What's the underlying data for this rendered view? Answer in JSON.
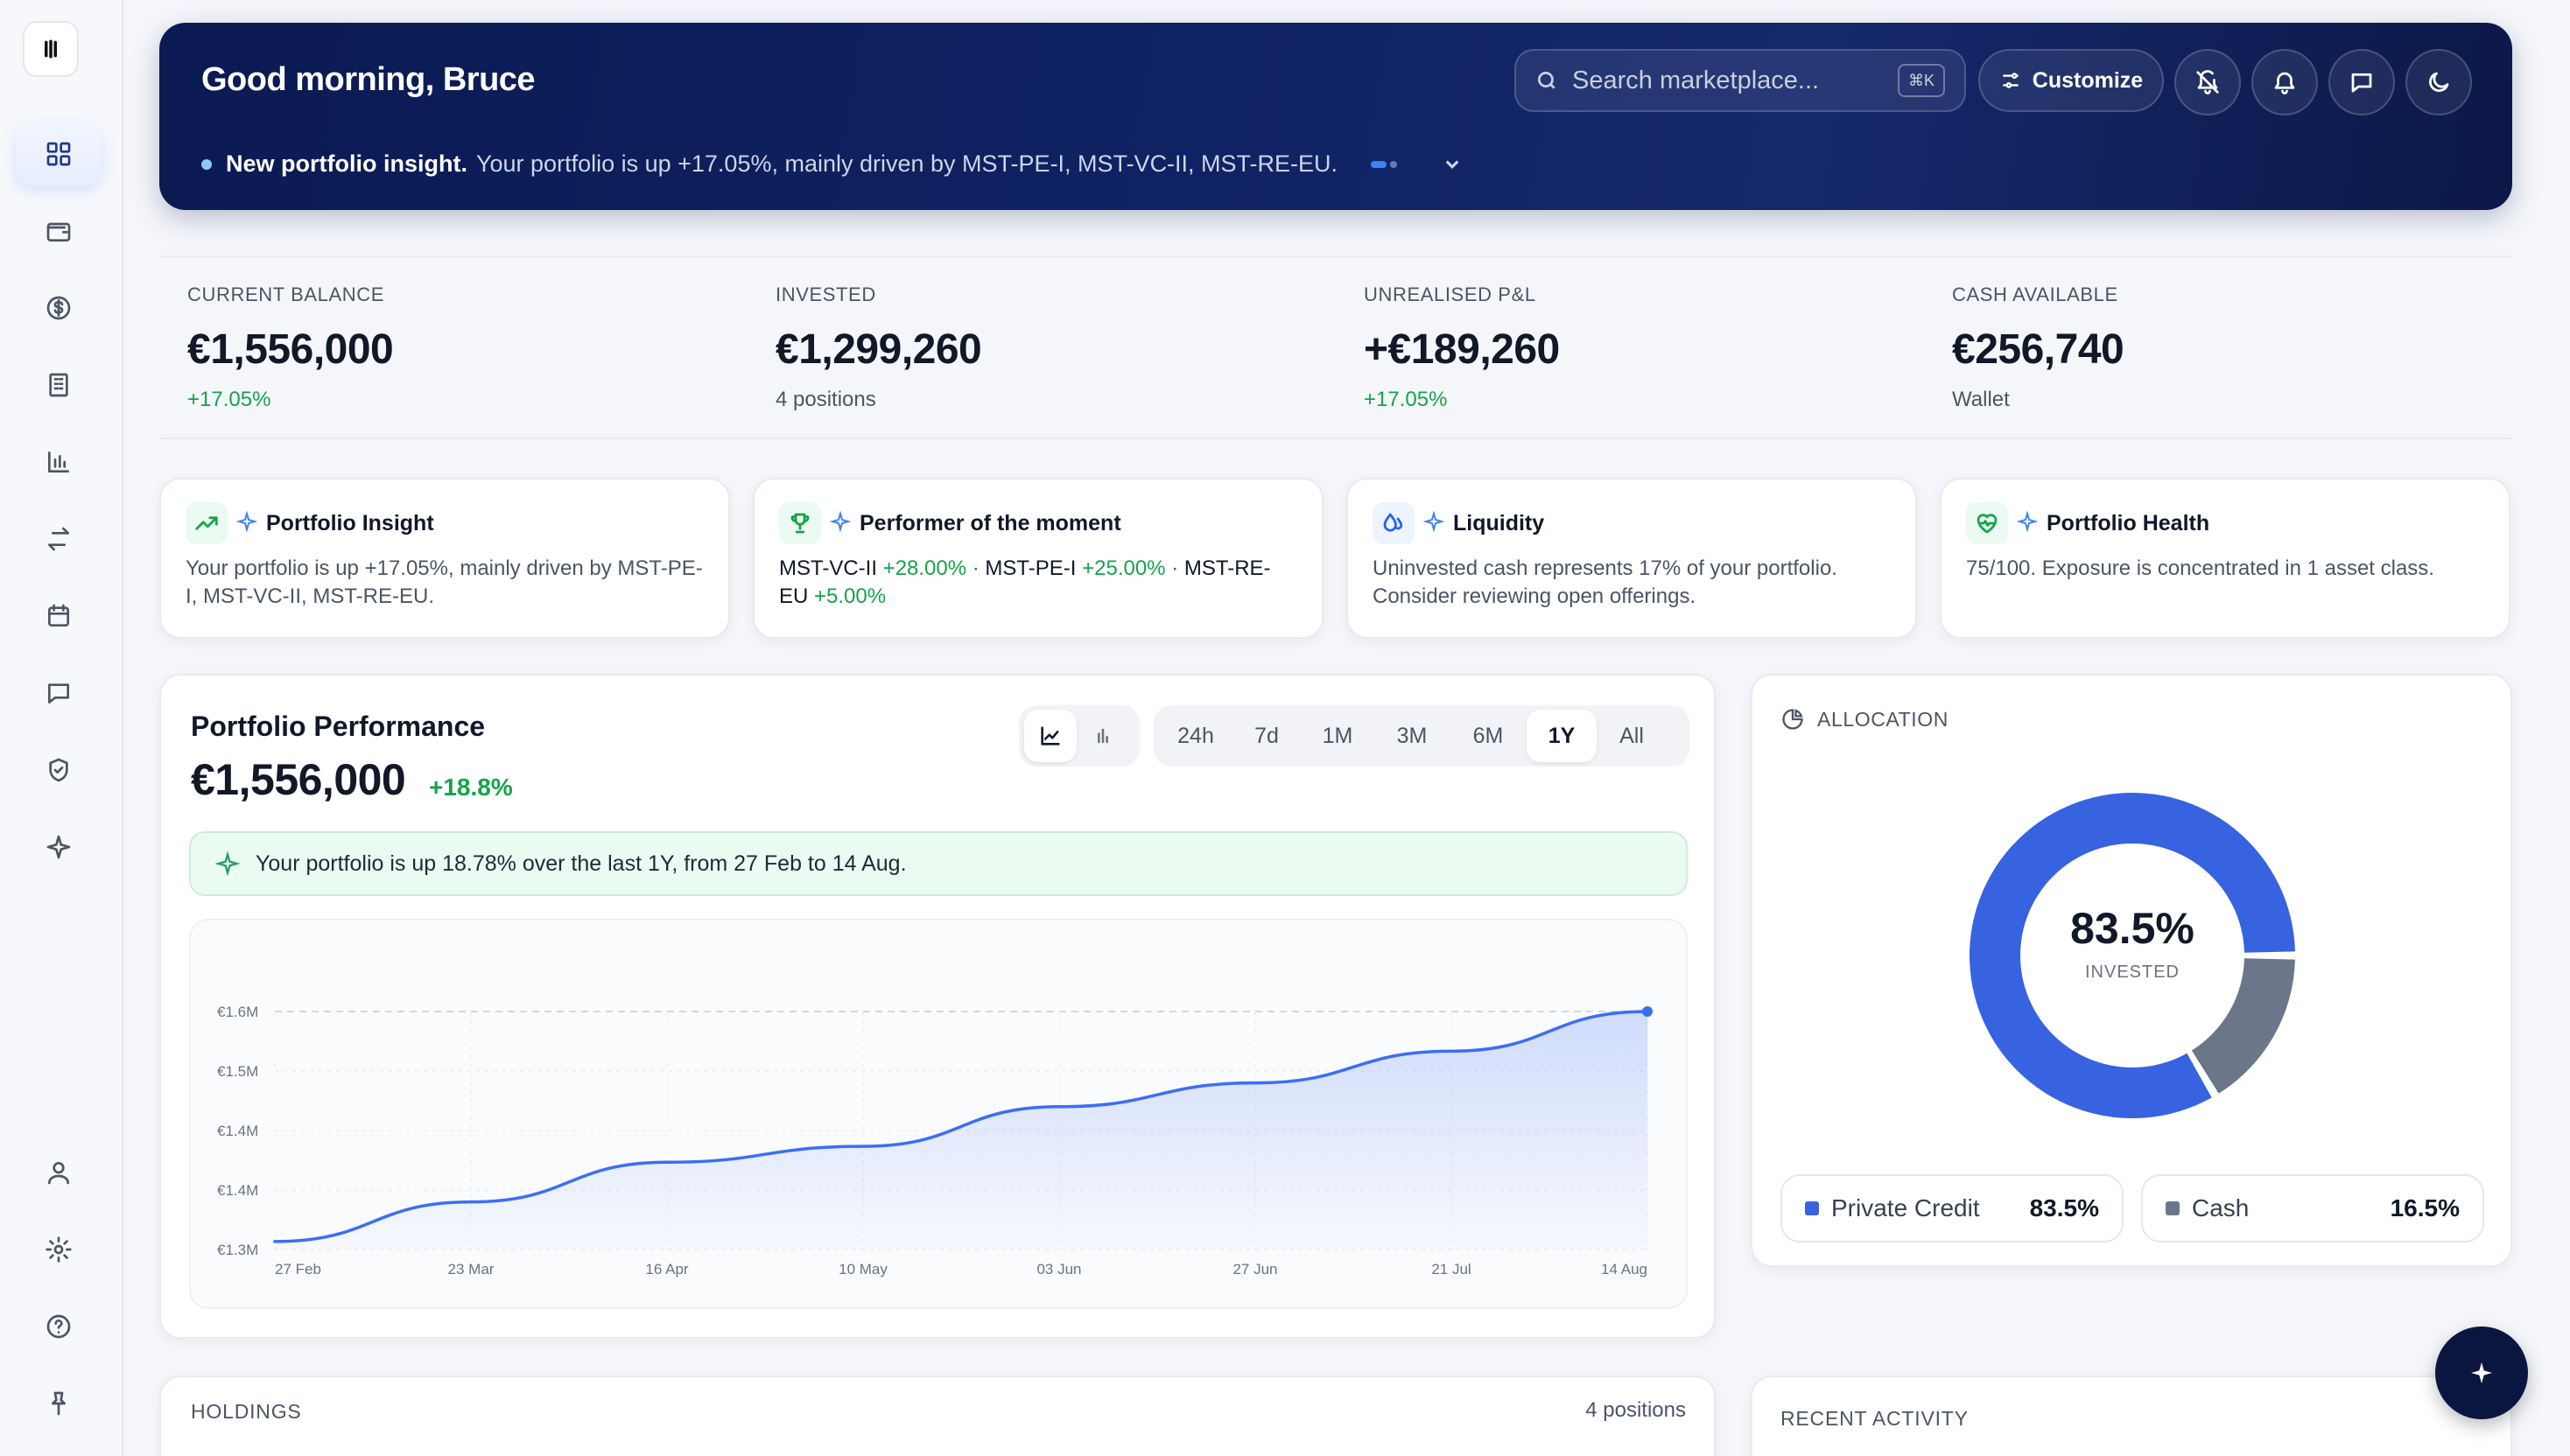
{
  "header": {
    "greeting": "Good morning, Bruce",
    "search_placeholder": "Search marketplace...",
    "search_shortcut": "⌘K",
    "customize_label": "Customize",
    "insight_title": "New portfolio insight.",
    "insight_text": "Your portfolio is up +17.05%, mainly driven by MST-PE-I, MST-VC-II, MST-RE-EU."
  },
  "sidebar": {
    "items": [
      "dashboard-icon",
      "wallet-icon",
      "dollar-icon",
      "building-icon",
      "bar-chart-icon",
      "swap-icon",
      "calendar-icon",
      "message-icon",
      "shield-icon",
      "sparkle-icon"
    ],
    "bottom_items": [
      "user-icon",
      "settings-icon",
      "help-icon",
      "pin-icon"
    ]
  },
  "stats": [
    {
      "label": "CURRENT BALANCE",
      "value": "€1,556,000",
      "sub": "+17.05%"
    },
    {
      "label": "INVESTED",
      "value": "€1,299,260",
      "sub": "4 positions"
    },
    {
      "label": "UNREALISED P&L",
      "value": "+€189,260",
      "sub": "+17.05%"
    },
    {
      "label": "CASH AVAILABLE",
      "value": "€256,740",
      "sub": "Wallet"
    }
  ],
  "insights": {
    "portfolio": {
      "title": "Portfolio Insight",
      "body": "Your portfolio is up +17.05%, mainly driven by MST-PE-I, MST-VC-II, MST-RE-EU."
    },
    "performer": {
      "title": "Performer of the moment",
      "a_name": "MST-VC-II",
      "a_pct": "+28.00%",
      "sep1": " · ",
      "b_name": "MST-PE-I",
      "b_pct": "+25.00%",
      "sep2": " · ",
      "c_name": "MST-RE-EU",
      "c_pct": "+5.00%"
    },
    "liquidity": {
      "title": "Liquidity",
      "body": "Uninvested cash represents 17% of your portfolio. Consider reviewing open offerings."
    },
    "health": {
      "title": "Portfolio Health",
      "body": "75/100. Exposure is concentrated in 1 asset class."
    }
  },
  "performance": {
    "title": "Portfolio Performance",
    "value": "€1,556,000",
    "change": "+18.8%",
    "ranges": [
      "24h",
      "7d",
      "1M",
      "3M",
      "6M",
      "1Y",
      "All"
    ],
    "active_range": "1Y",
    "banner": "Your portfolio is up 18.78% over the last 1Y, from 27 Feb to 14 Aug."
  },
  "chart_data": {
    "type": "area",
    "x": [
      "27 Feb",
      "23 Mar",
      "16 Apr",
      "10 May",
      "03 Jun",
      "27 Jun",
      "21 Jul",
      "14 Aug"
    ],
    "values": [
      1.31,
      1.36,
      1.41,
      1.43,
      1.48,
      1.51,
      1.55,
      1.6
    ],
    "y_ticks": [
      "€1.3M",
      "€1.4M",
      "€1.4M",
      "€1.5M",
      "€1.6M"
    ],
    "ylim": [
      1.3,
      1.6
    ],
    "grid": true,
    "color": "#3b6ef5"
  },
  "allocation": {
    "title": "ALLOCATION",
    "center_value": "83.5%",
    "center_label": "INVESTED",
    "segments": [
      {
        "name": "Private Credit",
        "pct": "83.5%",
        "value": 83.5,
        "color": "#3762e0"
      },
      {
        "name": "Cash",
        "pct": "16.5%",
        "value": 16.5,
        "color": "#6b7689"
      }
    ]
  },
  "holdings": {
    "title": "HOLDINGS",
    "count": "4 positions"
  },
  "recent": {
    "title": "RECENT ACTIVITY"
  }
}
